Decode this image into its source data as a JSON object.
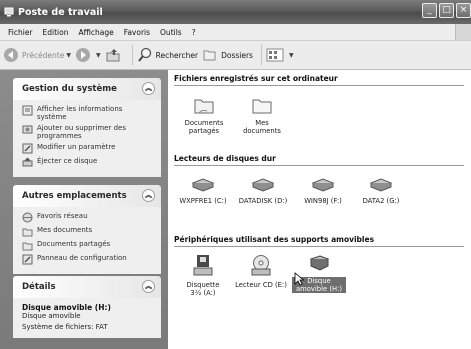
{
  "window": {
    "title": "Poste de travail"
  },
  "menu": [
    "Fichier",
    "Edition",
    "Affichage",
    "Favoris",
    "Outils",
    "?"
  ],
  "toolbar": {
    "back": "Précédente",
    "search": "Rechercher",
    "folders": "Dossiers"
  },
  "left": {
    "system": {
      "title": "Gestion du système",
      "items": [
        "Afficher les informations système",
        "Ajouter ou supprimer des programmes",
        "Modifier un paramètre",
        "Éjecter ce disque"
      ]
    },
    "places": {
      "title": "Autres emplacements",
      "items": [
        "Favoris réseau",
        "Mes documents",
        "Documents partagés",
        "Panneau de configuration"
      ]
    },
    "details": {
      "title": "Détails",
      "name": "Disque amovible (H:)",
      "type": "Disque amovible",
      "fs": "Système de fichiers: FAT"
    }
  },
  "main": {
    "files_heading": "Fichiers enregistrés sur cet ordinateur",
    "files": [
      "Documents partagés",
      "Mes documents"
    ],
    "drives_heading": "Lecteurs de disques dur",
    "drives": [
      "WXPFRE1 (C:)",
      "DATADISK (D:)",
      "WIN98J (F:)",
      "DATA2 (G:)"
    ],
    "removable_heading": "Périphériques utilisant des supports amovibles",
    "removable": [
      "Disquette 3½ (A:)",
      "Lecteur CD (E:)",
      "Disque amovible (H:)"
    ]
  }
}
